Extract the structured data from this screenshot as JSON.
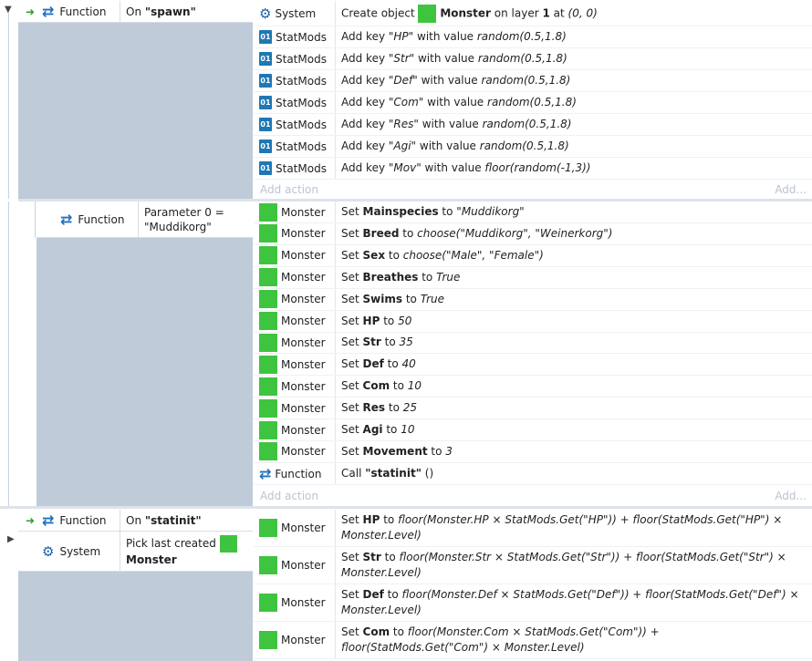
{
  "events": [
    {
      "conditions": [
        {
          "object": "Function",
          "icon": "cycle-icon",
          "text_prefix": "On ",
          "text_bold": "\"spawn\""
        }
      ],
      "actions": [
        {
          "object": "System",
          "icon": "gear-icon",
          "parts": [
            "Create object ",
            "Monster",
            " on layer ",
            "1",
            " at ",
            "(0, 0)"
          ]
        },
        {
          "object": "StatMods",
          "icon": "dictionary-icon",
          "key": "\"HP\"",
          "value": "random(0.5,1.8)"
        },
        {
          "object": "StatMods",
          "icon": "dictionary-icon",
          "key": "\"Str\"",
          "value": "random(0.5,1.8)"
        },
        {
          "object": "StatMods",
          "icon": "dictionary-icon",
          "key": "\"Def\"",
          "value": "random(0.5,1.8)"
        },
        {
          "object": "StatMods",
          "icon": "dictionary-icon",
          "key": "\"Com\"",
          "value": "random(0.5,1.8)"
        },
        {
          "object": "StatMods",
          "icon": "dictionary-icon",
          "key": "\"Res\"",
          "value": "random(0.5,1.8)"
        },
        {
          "object": "StatMods",
          "icon": "dictionary-icon",
          "key": "\"Agi\"",
          "value": "random(0.5,1.8)"
        },
        {
          "object": "StatMods",
          "icon": "dictionary-icon",
          "key": "\"Mov\"",
          "value": "floor(random(-1,3))"
        }
      ],
      "add_action": "Add action",
      "add_more": "Add..."
    },
    {
      "conditions": [
        {
          "object": "Function",
          "icon": "cycle-icon",
          "param_line1": "Parameter 0 =",
          "param_line2": "\"Muddikorg\""
        }
      ],
      "actions": [
        {
          "object": "Monster",
          "field": "Mainspecies",
          "value": "\"Muddikorg\""
        },
        {
          "object": "Monster",
          "field": "Breed",
          "value": "choose(\"Muddikorg\", \"Weinerkorg\")"
        },
        {
          "object": "Monster",
          "field": "Sex",
          "value": "choose(\"Male\", \"Female\")"
        },
        {
          "object": "Monster",
          "field": "Breathes",
          "value": "True"
        },
        {
          "object": "Monster",
          "field": "Swims",
          "value": "True"
        },
        {
          "object": "Monster",
          "field": "HP",
          "value": "50"
        },
        {
          "object": "Monster",
          "field": "Str",
          "value": "35"
        },
        {
          "object": "Monster",
          "field": "Def",
          "value": "40"
        },
        {
          "object": "Monster",
          "field": "Com",
          "value": "10"
        },
        {
          "object": "Monster",
          "field": "Res",
          "value": "25"
        },
        {
          "object": "Monster",
          "field": "Agi",
          "value": "10"
        },
        {
          "object": "Monster",
          "field": "Movement",
          "value": "3"
        }
      ],
      "call_action": {
        "object": "Function",
        "icon": "cycle-icon",
        "prefix": "Call ",
        "name": "\"statinit\"",
        "suffix": " ()"
      },
      "add_action": "Add action",
      "add_more": "Add..."
    },
    {
      "conditions": [
        {
          "object": "Function",
          "icon": "cycle-icon",
          "text_prefix": "On ",
          "text_bold": "\"statinit\""
        },
        {
          "object": "System",
          "icon": "gear-icon",
          "line1": "Pick last created",
          "line2": "Monster"
        }
      ],
      "actions": [
        {
          "object": "Monster",
          "field": "HP",
          "value": "floor(Monster.HP × StatMods.Get(\"HP\")) + floor(StatMods.Get(\"HP\") × Monster.Level)"
        },
        {
          "object": "Monster",
          "field": "Str",
          "value": "floor(Monster.Str × StatMods.Get(\"Str\")) + floor(StatMods.Get(\"Str\") × Monster.Level)"
        },
        {
          "object": "Monster",
          "field": "Def",
          "value": "floor(Monster.Def × StatMods.Get(\"Def\")) + floor(StatMods.Get(\"Def\") × Monster.Level)"
        },
        {
          "object": "Monster",
          "field": "Com",
          "value": "floor(Monster.Com × StatMods.Get(\"Com\")) + floor(StatMods.Get(\"Com\") × Monster.Level)"
        }
      ]
    }
  ],
  "labels": {
    "add_key": "Add key ",
    "with_value": " with value ",
    "set": "Set ",
    "to": " to "
  },
  "colors": {
    "condition_panel": "#bfcbd9",
    "monster_swatch": "#3fc43f",
    "icon_blue": "#1d6fbf"
  }
}
